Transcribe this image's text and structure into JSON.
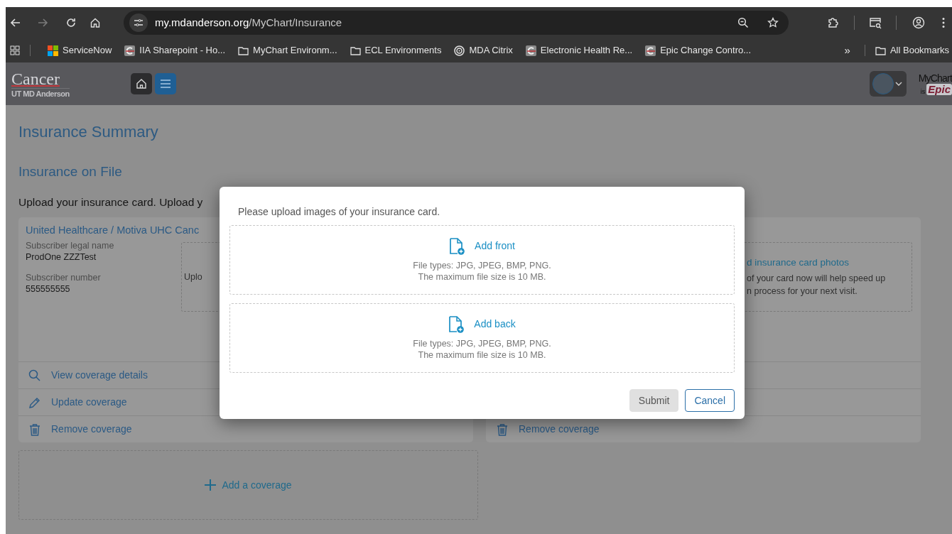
{
  "browser": {
    "forward": {
      "disabled": true
    },
    "url": {
      "host": "my.mdanderson.org",
      "path": "/MyChart/Insurance"
    },
    "bookmarks": [
      {
        "kind": "windows",
        "label": "ServiceNow"
      },
      {
        "kind": "c-logo",
        "label": "IIA Sharepoint - Ho..."
      },
      {
        "kind": "folder",
        "label": "MyChart Environm..."
      },
      {
        "kind": "folder",
        "label": "ECL Environments"
      },
      {
        "kind": "citrix",
        "label": "MDA Citrix"
      },
      {
        "kind": "c-logo",
        "label": "Electronic Health Re..."
      },
      {
        "kind": "c-logo",
        "label": "Epic Change Contro..."
      }
    ],
    "overflow": "»",
    "all_bookmarks": "All Bookmarks"
  },
  "app_header": {
    "logo": {
      "wordmark": "Cancer",
      "name": "UT MD Anderson"
    },
    "mychart_logo": {
      "name": "MyChart",
      "by": "is",
      "brand": "Epic"
    }
  },
  "page": {
    "title": "Insurance Summary",
    "section_title": "Insurance on File",
    "intro": "Upload your insurance card. Upload y",
    "coverages": [
      {
        "title": "United Healthcare / Motiva UHC Canc",
        "fields": [
          {
            "label": "Subscriber legal name",
            "value": "ProdOne ZZZTest"
          },
          {
            "label": "Subscriber number",
            "value": "555555555"
          }
        ],
        "upload_box": {
          "lines": [
            "Uplo"
          ]
        },
        "actions": [
          {
            "kind": "view",
            "label": "View coverage details"
          },
          {
            "kind": "update",
            "label": "Update coverage"
          },
          {
            "kind": "remove",
            "label": "Remove coverage"
          }
        ]
      },
      {
        "upload_box": {
          "title": "d insurance card photos",
          "lines": [
            "of your card now will help speed up",
            "n process for your next visit."
          ]
        },
        "actions": [
          {
            "kind": "hidden"
          },
          {
            "kind": "hidden"
          },
          {
            "kind": "remove",
            "label": "Remove coverage"
          }
        ]
      }
    ],
    "add_coverage": "Add a coverage"
  },
  "modal": {
    "prompt": "Please upload images of your insurance card.",
    "dropzones": [
      {
        "label": "Add front",
        "types": "File types: JPG, JPEG, BMP, PNG.",
        "max": "The maximum file size is 10 MB."
      },
      {
        "label": "Add back",
        "types": "File types: JPG, JPEG, BMP, PNG.",
        "max": "The maximum file size is 10 MB."
      }
    ],
    "buttons": [
      {
        "label": "Submit",
        "disabled": true
      },
      {
        "label": "Cancel",
        "disabled": false
      }
    ]
  }
}
